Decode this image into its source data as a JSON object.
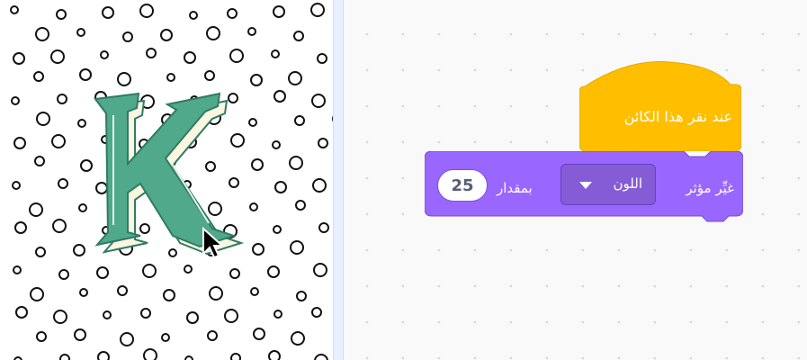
{
  "stage": {
    "sprite_letter": "K",
    "colors": {
      "sprite_green": "#4fa98a",
      "sprite_cream": "#fbf6e0",
      "backdrop_dots": "#111111"
    }
  },
  "script": {
    "hat_block": {
      "label": "عند نقر هذا الكائن",
      "color": "#ffbf00"
    },
    "effect_block": {
      "label_change": "غيِّر مؤثر",
      "effect_option": "اللون",
      "label_by": "بمقدار",
      "value": "25",
      "color": "#9966ff"
    }
  },
  "icons": {
    "cursor": "mouse-pointer-icon",
    "dropdown": "triangle-down-icon"
  }
}
